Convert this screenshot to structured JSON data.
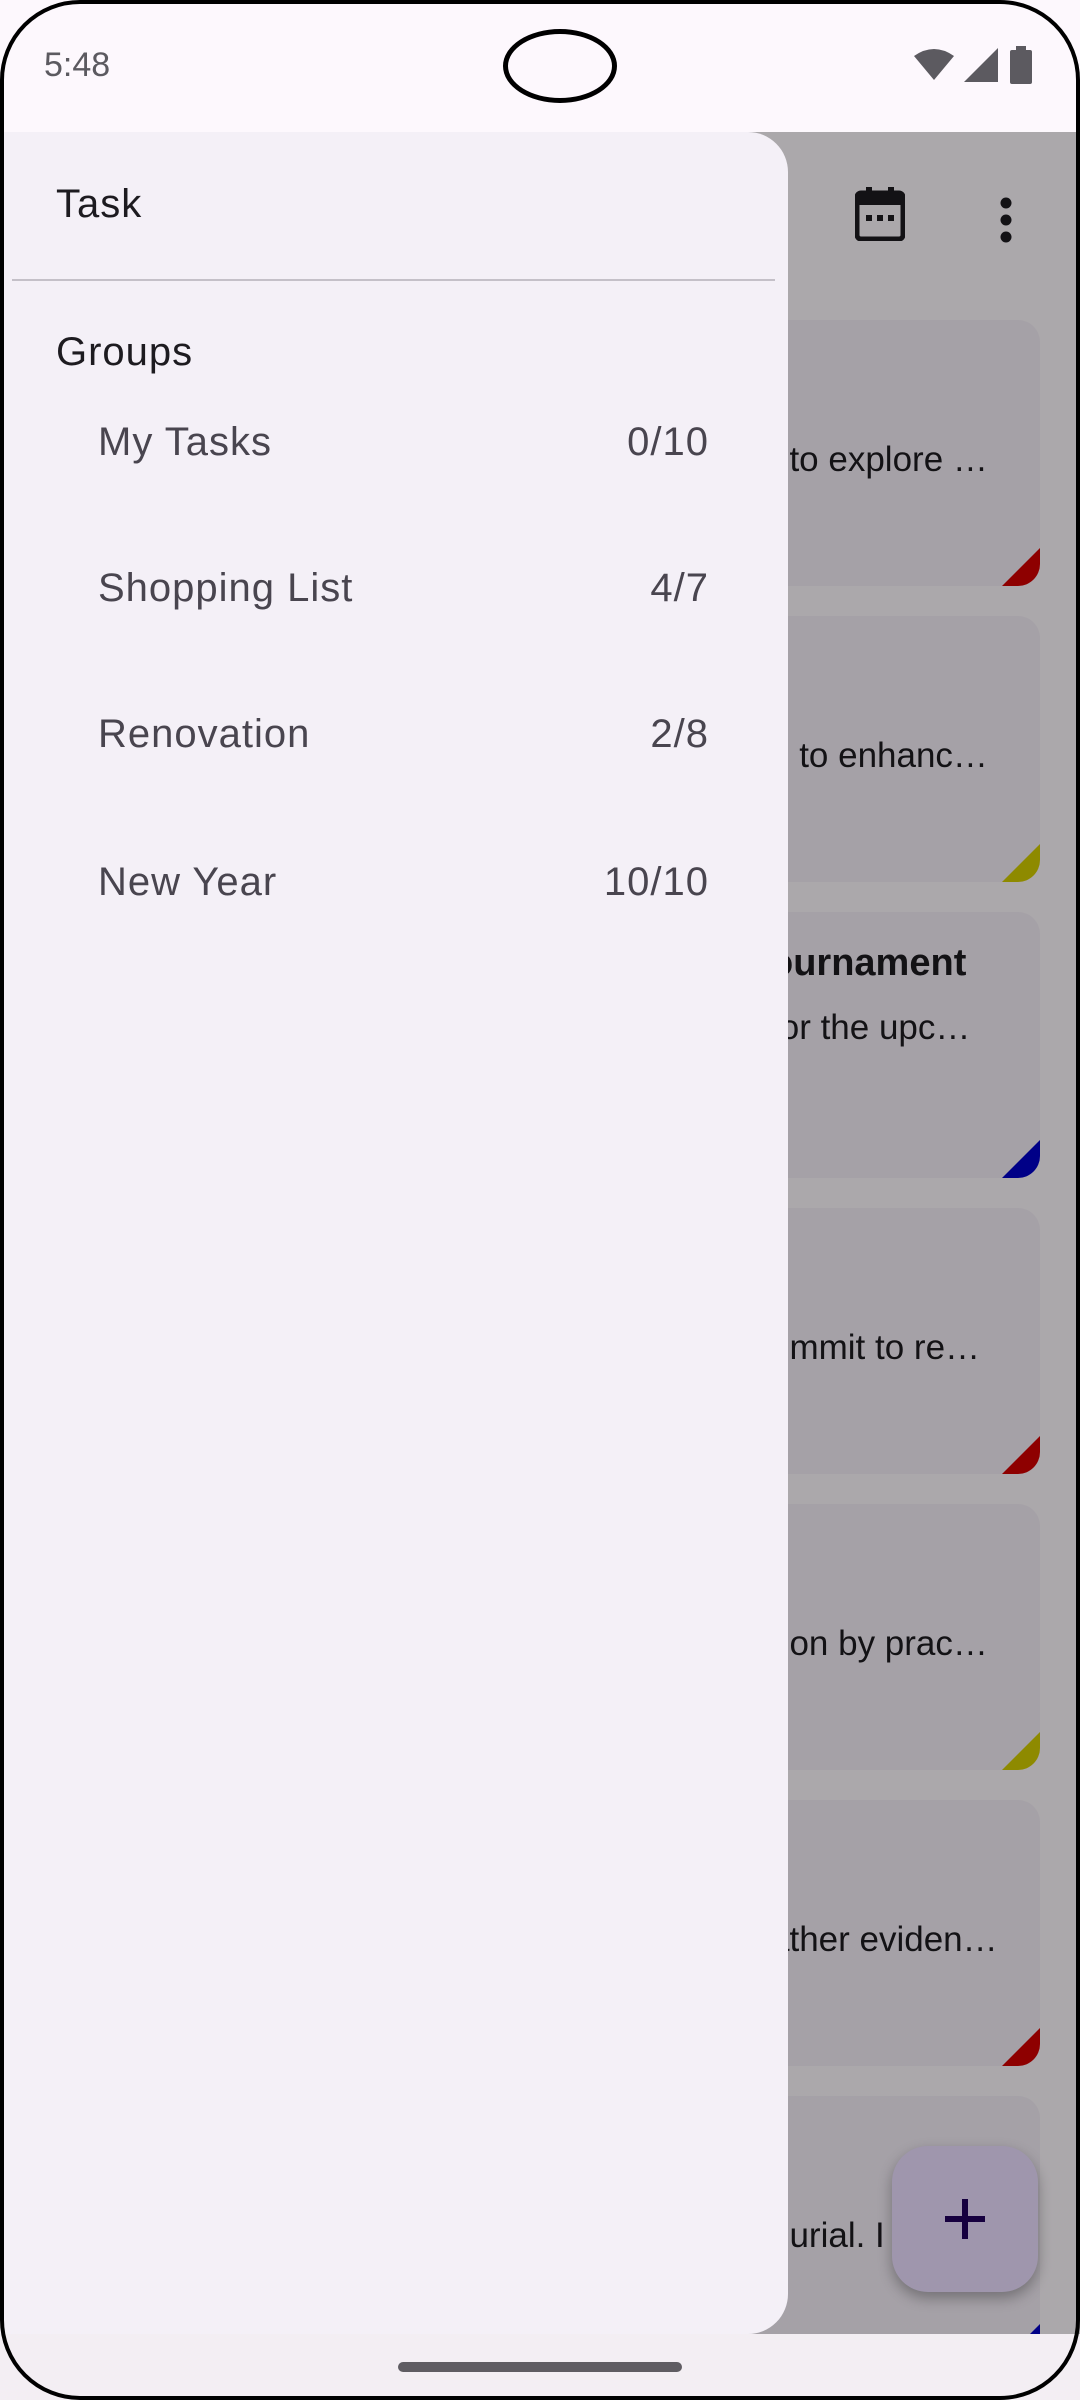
{
  "status_bar": {
    "time": "5:48",
    "icons": [
      "wifi-icon",
      "signal-icon",
      "battery-icon"
    ]
  },
  "drawer": {
    "title": "Task",
    "section_label": "Groups",
    "groups": [
      {
        "name": "My Tasks",
        "count": "0/10"
      },
      {
        "name": "Shopping List",
        "count": "4/7"
      },
      {
        "name": "Renovation",
        "count": "2/8"
      },
      {
        "name": "New Year",
        "count": "10/10"
      }
    ]
  },
  "background_app": {
    "toolbar_icons": [
      "calendar-icon",
      "more-vert-icon"
    ],
    "cards": [
      {
        "title": "",
        "desc": "t to explore …",
        "priority_color": "#d20000"
      },
      {
        "title": "",
        "desc": "p to enhanc…",
        "priority_color": "#d2cc00"
      },
      {
        "title": "ournament",
        "desc": " for the upc…",
        "priority_color": "#0000c8"
      },
      {
        "title": "",
        "desc": "ummit to re…",
        "priority_color": "#d20000"
      },
      {
        "title": "",
        "desc": "hon by prac…",
        "priority_color": "#d2cc00"
      },
      {
        "title": "",
        "desc": "ather eviden…",
        "priority_color": "#d20000"
      },
      {
        "title": "",
        "desc": "ourial. I",
        "priority_color": "#0000c8"
      }
    ],
    "fab_icon": "add-icon"
  },
  "colors": {
    "drawer_bg": "#f4f0f7",
    "card_bg": "#f3edf6",
    "fab_bg": "#eaddff",
    "scrim": "rgba(0,0,0,0.32)"
  }
}
